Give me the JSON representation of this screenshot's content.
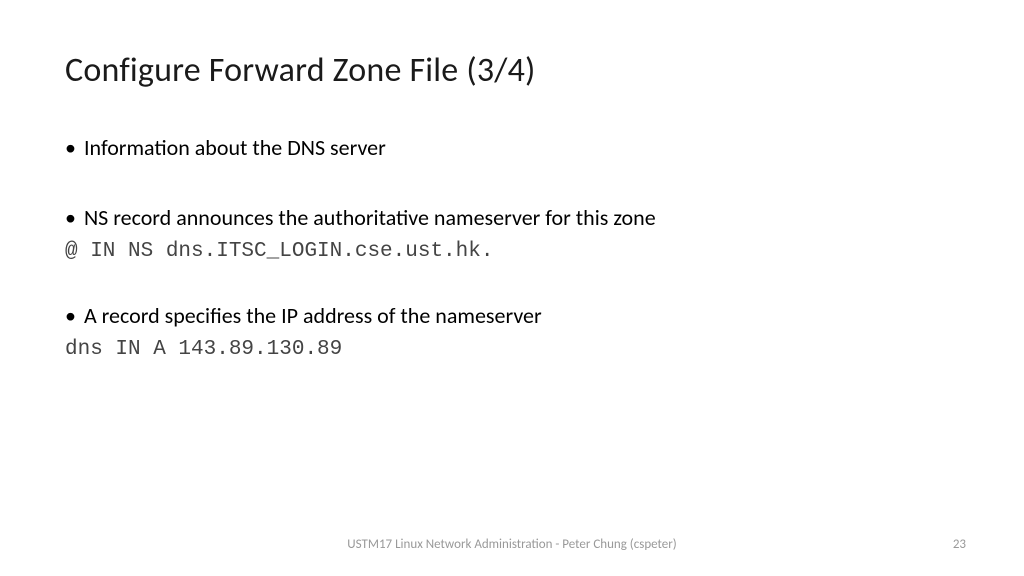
{
  "title": "Configure Forward Zone File (3/4)",
  "bullets": {
    "b1": "Information about the DNS server",
    "b2": "NS record announces the authoritative nameserver for this zone",
    "code1": "@ IN NS dns.ITSC_LOGIN.cse.ust.hk.",
    "b3": "A record specifies the IP address of the nameserver",
    "code2": "dns IN A 143.89.130.89"
  },
  "footer": {
    "text": "USTM17 Linux Network Administration - Peter Chung (cspeter)",
    "page": "23"
  }
}
